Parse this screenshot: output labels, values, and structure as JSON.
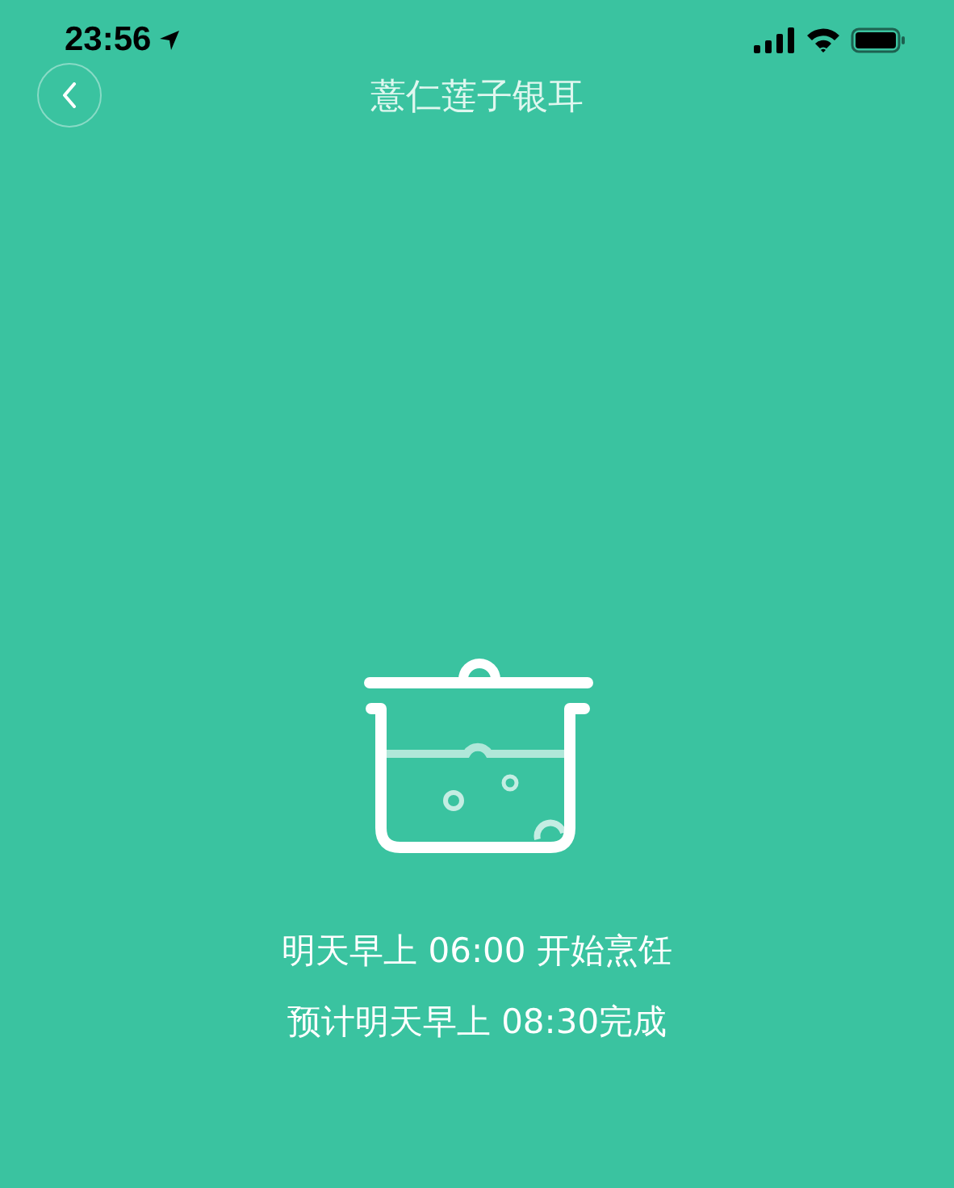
{
  "status_bar": {
    "time": "23:56"
  },
  "nav": {
    "title": "薏仁莲子银耳"
  },
  "schedule": {
    "start": "明天早上 06:00 开始烹饪",
    "finish": "预计明天早上 08:30完成"
  }
}
